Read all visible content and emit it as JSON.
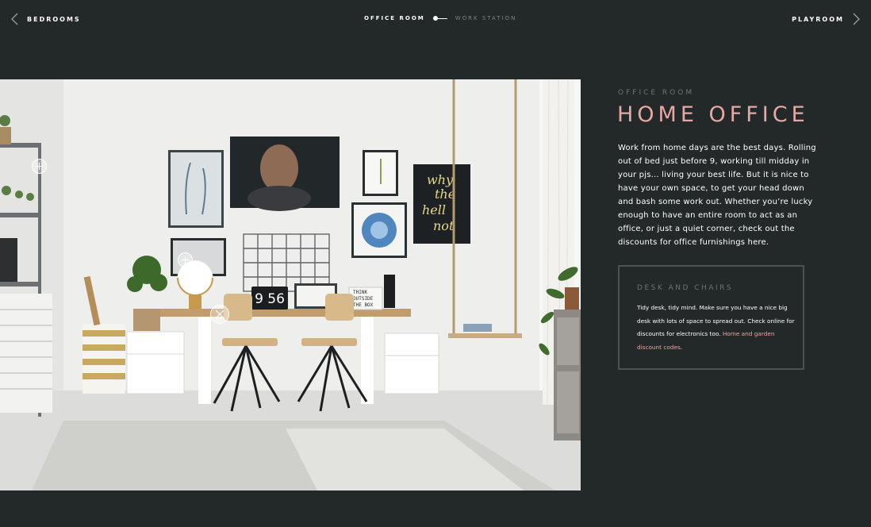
{
  "nav": {
    "prev_label": "BEDROOMS",
    "next_label": "PLAYROOM",
    "current_crumb": "OFFICE ROOM",
    "next_crumb": "WORK STATION"
  },
  "section": {
    "overline": "OFFICE ROOM",
    "title": "HOME OFFICE",
    "body": "Work from home days are the best days. Rolling out of bed just before 9, working till midday in your pjs... living your best life. But it is nice to have your own space, to get your head down and bash some work out. Whether you’re lucky enough to have an entire room to act as an office, or just a quiet corner, check out the discounts for office furnishings here."
  },
  "card": {
    "title": "DESK AND CHAIRS",
    "text": "Tidy desk, tidy mind. Make sure you have a nice big desk with lots of space to spread out. Check online for discounts for electronics too.",
    "link_text": "Home and garden discount codes",
    "link_suffix": "."
  },
  "scene": {
    "clock_text": "9 56",
    "lightbox_lines": [
      "THINK",
      "OUTSIDE",
      "THE BOX"
    ],
    "poster_lines": [
      "why",
      "the",
      "hell",
      "not"
    ]
  },
  "colors": {
    "background": "#232929",
    "accent": "#e7a7a4",
    "muted": "#6b7373",
    "card_border": "#4a5252"
  }
}
